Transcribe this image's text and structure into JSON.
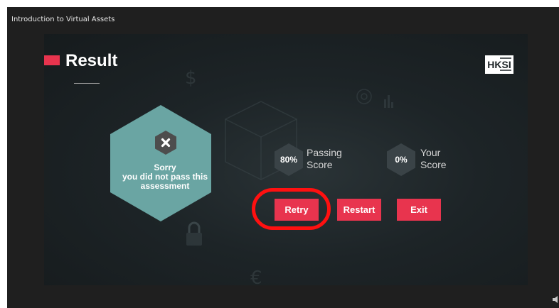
{
  "window": {
    "course_title": "Introduction to Virtual Assets"
  },
  "header": {
    "title": "Result",
    "logo_text": "HKSI"
  },
  "result": {
    "status_icon": "close-icon",
    "message_line1": "Sorry",
    "message_line2": "you did not pass this",
    "message_line3": "assessment"
  },
  "scores": {
    "passing": {
      "value": "80%",
      "label_line1": "Passing",
      "label_line2": "Score"
    },
    "yours": {
      "value": "0%",
      "label_line1": "Your",
      "label_line2": "Score"
    }
  },
  "buttons": {
    "retry": "Retry",
    "restart": "Restart",
    "exit": "Exit"
  },
  "colors": {
    "accent": "#e8344e",
    "result_hex": "#6aa5a3",
    "score_hex": "#3a4347",
    "annotation": "#ff1010"
  },
  "icons": {
    "volume": "volume-icon"
  }
}
